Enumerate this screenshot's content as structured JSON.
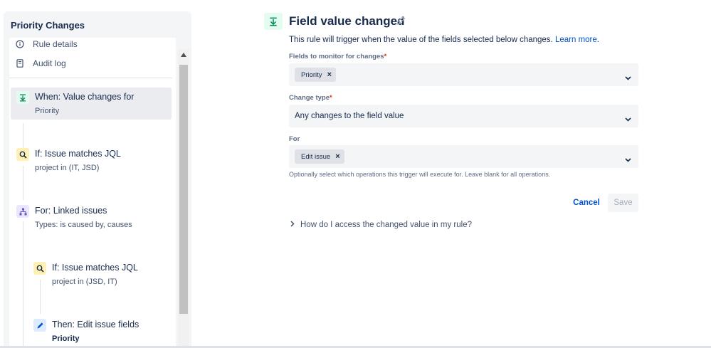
{
  "sidebar": {
    "title": "Priority Changes",
    "nav": [
      {
        "label": "Rule details",
        "icon": "info-icon"
      },
      {
        "label": "Audit log",
        "icon": "document-icon"
      }
    ],
    "steps": [
      {
        "title": "When: Value changes for",
        "sub": "Priority",
        "icon": "trigger-icon",
        "color": "#00875a"
      },
      {
        "title": "If: Issue matches JQL",
        "sub": "project in (IT, JSD)",
        "icon": "search-icon",
        "color": "#ff991f"
      },
      {
        "title": "For: Linked issues",
        "sub": "Types: is caused by, causes",
        "icon": "hierarchy-icon",
        "color": "#6554c0"
      },
      {
        "title": "If: Issue matches JQL",
        "sub": "project in (JSD, IT)",
        "icon": "search-icon",
        "color": "#ff991f"
      },
      {
        "title": "Then: Edit issue fields",
        "sub": "Priority",
        "icon": "pencil-icon",
        "color": "#0052cc"
      }
    ]
  },
  "main": {
    "title": "Field value changed",
    "description": "This rule will trigger when the value of the fields selected below changes.",
    "learn_more": "Learn more.",
    "fields_label": "Fields to monitor for changes",
    "fields_tag": "Priority",
    "change_type_label": "Change type",
    "change_type_value": "Any changes to the field value",
    "for_label": "For",
    "for_tag": "Edit issue",
    "helper": "Optionally select which operations this trigger will execute for. Leave blank for all operations.",
    "cancel": "Cancel",
    "save": "Save",
    "expander": "How do I access the changed value in my rule?",
    "required_mark": "*"
  },
  "colors": {
    "link": "#0052cc",
    "trigger_bg": "#e3fcef",
    "trigger": "#00875a"
  }
}
